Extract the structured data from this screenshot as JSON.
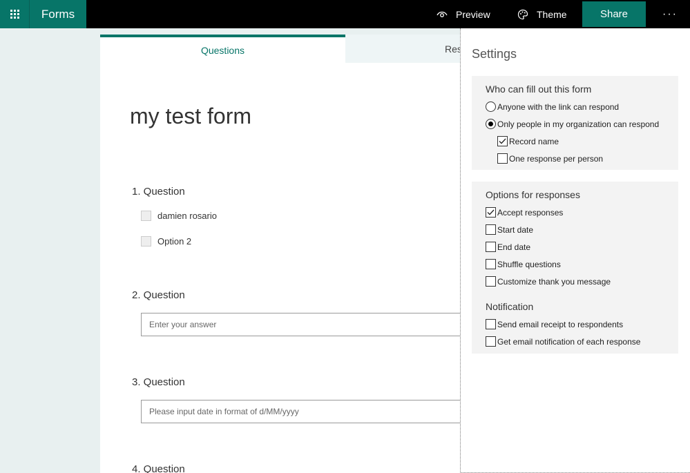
{
  "app": {
    "name": "Forms"
  },
  "topbar": {
    "preview_label": "Preview",
    "theme_label": "Theme",
    "share_label": "Share",
    "more_label": "···"
  },
  "tabs": {
    "questions": "Questions",
    "responses": "Res"
  },
  "form": {
    "title": "my test form",
    "questions": [
      {
        "label": "1. Question",
        "options": [
          "damien rosario",
          "Option 2"
        ]
      },
      {
        "label": "2. Question",
        "placeholder": "Enter your answer"
      },
      {
        "label": "3. Question",
        "placeholder": "Please input date in format of d/MM/yyyy"
      },
      {
        "label": "4. Question"
      }
    ]
  },
  "settings": {
    "title": "Settings",
    "who": {
      "title": "Who can fill out this form",
      "anyone": {
        "label": "Anyone with the link can respond",
        "selected": false
      },
      "org": {
        "label": "Only people in my organization can respond",
        "selected": true
      },
      "record_name": {
        "label": "Record name",
        "checked": true
      },
      "one_response": {
        "label": "One response per person",
        "checked": false
      }
    },
    "options": {
      "title": "Options for responses",
      "accept": {
        "label": "Accept responses",
        "checked": true
      },
      "start_date": {
        "label": "Start date",
        "checked": false
      },
      "end_date": {
        "label": "End date",
        "checked": false
      },
      "shuffle": {
        "label": "Shuffle questions",
        "checked": false
      },
      "thanks": {
        "label": "Customize thank you message",
        "checked": false
      }
    },
    "notification": {
      "title": "Notification",
      "receipt": {
        "label": "Send email receipt to respondents",
        "checked": false
      },
      "each": {
        "label": "Get email notification of each response",
        "checked": false
      }
    }
  },
  "colors": {
    "brand": "#077568",
    "topbar": "#000000",
    "page_bg": "#e8f0f0"
  }
}
